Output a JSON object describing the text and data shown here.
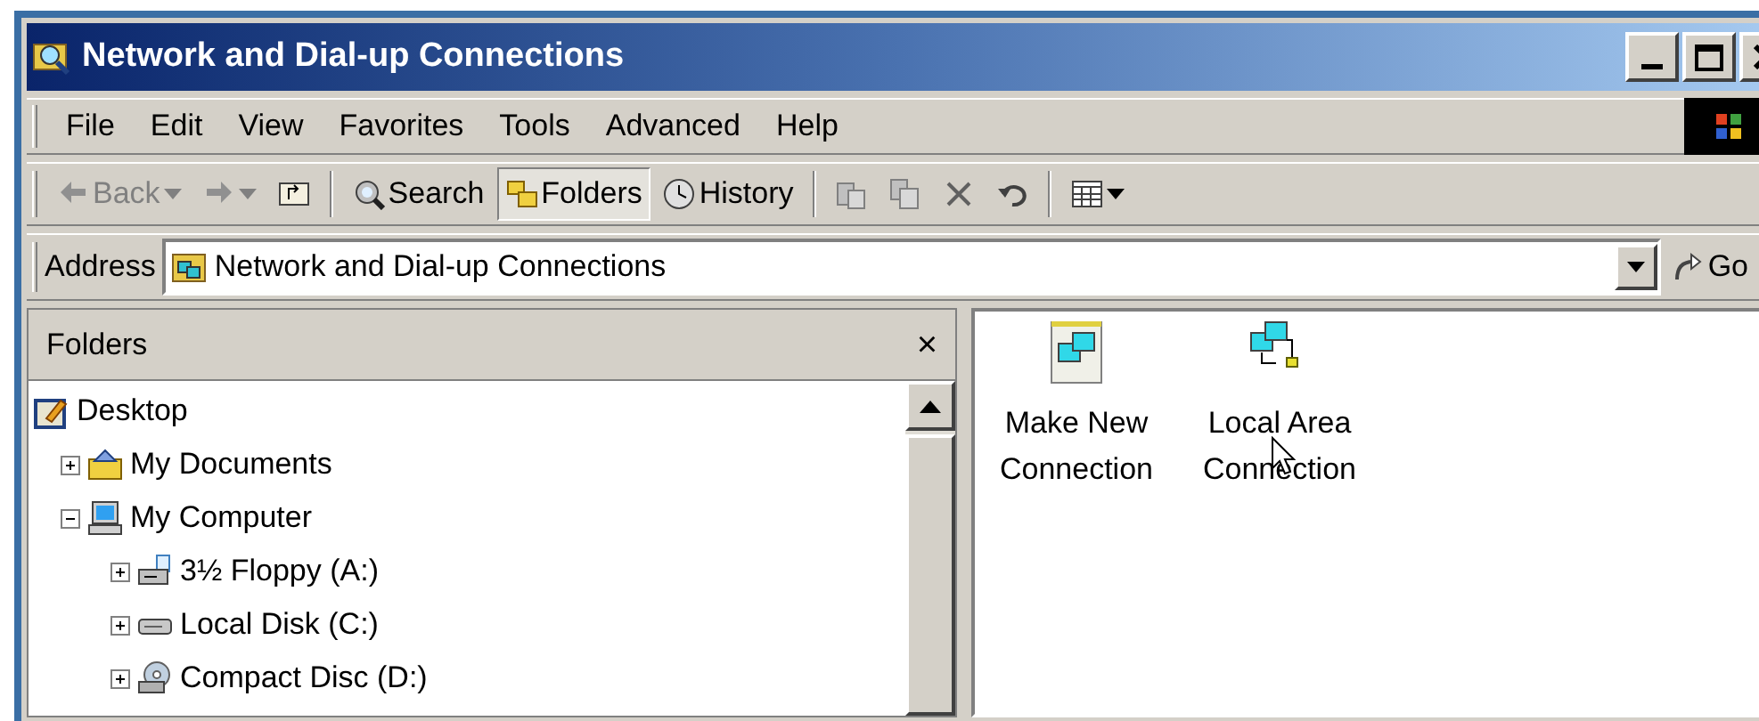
{
  "window": {
    "title": "Network and Dial-up Connections"
  },
  "menu": [
    "File",
    "Edit",
    "View",
    "Favorites",
    "Tools",
    "Advanced",
    "Help"
  ],
  "toolbar": [
    {
      "kind": "back",
      "label": "Back",
      "disabled": true
    },
    {
      "kind": "forward",
      "disabled": true
    },
    {
      "kind": "up"
    },
    {
      "kind": "search",
      "label": "Search",
      "selected": false
    },
    {
      "kind": "folders",
      "label": "Folders",
      "selected": true
    },
    {
      "kind": "history",
      "label": "History",
      "selected": false
    },
    {
      "kind": "move"
    },
    {
      "kind": "copy"
    },
    {
      "kind": "delete"
    },
    {
      "kind": "undo"
    },
    {
      "kind": "views"
    }
  ],
  "address": {
    "label": "Address",
    "value": "Network and Dial-up Connections",
    "go": "Go"
  },
  "folders_pane": {
    "title": "Folders",
    "close": "×"
  },
  "tree": [
    {
      "label": "Desktop",
      "kind": "desktop",
      "children": [
        {
          "label": "My Documents",
          "kind": "documents",
          "expanded": false
        },
        {
          "label": "My Computer",
          "kind": "computer",
          "expanded": true,
          "children": [
            {
              "label": "3½ Floppy (A:)",
              "kind": "floppy",
              "expanded": false
            },
            {
              "label": "Local Disk (C:)",
              "kind": "disk",
              "expanded": false
            },
            {
              "label": "Compact Disc (D:)",
              "kind": "cd",
              "expanded": false
            }
          ]
        }
      ]
    }
  ],
  "items": [
    {
      "label": "Make New Connection",
      "kind": "wizard"
    },
    {
      "label": "Local Area Connection",
      "kind": "lan"
    }
  ]
}
